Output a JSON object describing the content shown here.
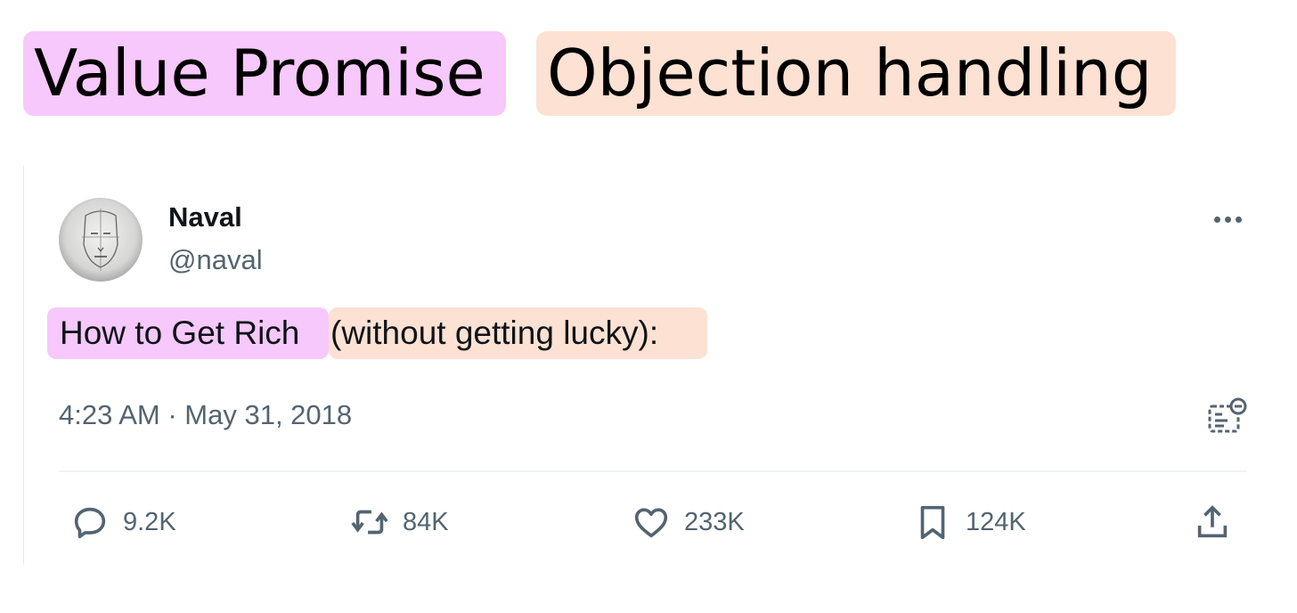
{
  "labels": {
    "value_promise": "Value Promise",
    "objection_handling": "Objection handling"
  },
  "tweet": {
    "author": {
      "name": "Naval",
      "handle": "@naval"
    },
    "text": {
      "value_part": "How to Get Rich",
      "objection_part": "(without getting lucky):"
    },
    "timestamp": "4:23 AM · May 31, 2018",
    "actions": {
      "replies": "9.2K",
      "reposts": "84K",
      "likes": "233K",
      "bookmarks": "124K"
    }
  },
  "colors": {
    "value_highlight": "#f7c8fb",
    "objection_highlight": "#fde1d3",
    "text_primary": "#0f1419",
    "text_secondary": "#536471"
  },
  "icons": [
    "more-icon",
    "notes-icon",
    "reply-icon",
    "repost-icon",
    "like-icon",
    "bookmark-icon",
    "share-icon"
  ]
}
